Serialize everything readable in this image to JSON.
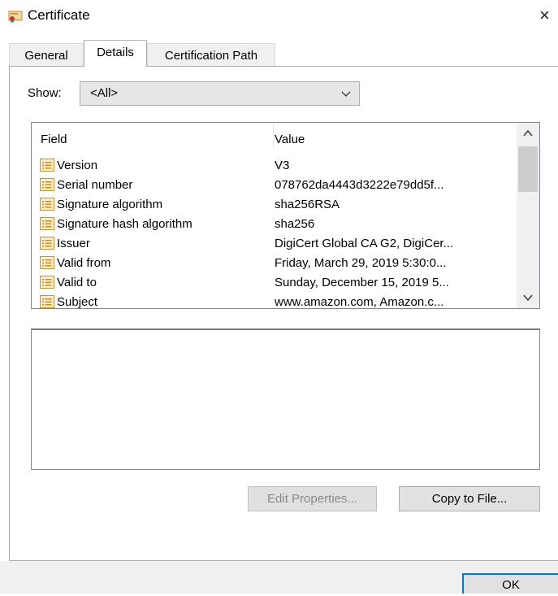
{
  "window": {
    "title": "Certificate",
    "title_icon": "certificate-icon",
    "close_glyph": "×"
  },
  "tabs": [
    {
      "label": "General",
      "selected": false
    },
    {
      "label": "Details",
      "selected": true
    },
    {
      "label": "Certification Path",
      "selected": false
    }
  ],
  "show": {
    "label": "Show:",
    "value": "<All>"
  },
  "list": {
    "headers": {
      "field": "Field",
      "value": "Value"
    },
    "rows": [
      {
        "field": "Version",
        "value": "V3"
      },
      {
        "field": "Serial number",
        "value": "078762da4443d3222e79dd5f..."
      },
      {
        "field": "Signature algorithm",
        "value": "sha256RSA"
      },
      {
        "field": "Signature hash algorithm",
        "value": "sha256"
      },
      {
        "field": "Issuer",
        "value": "DigiCert Global CA G2, DigiCer..."
      },
      {
        "field": "Valid from",
        "value": "Friday, March 29, 2019 5:30:0..."
      },
      {
        "field": "Valid to",
        "value": "Sunday, December 15, 2019 5..."
      },
      {
        "field": "Subject",
        "value": "www.amazon.com, Amazon.c..."
      }
    ]
  },
  "buttons": {
    "edit_properties": "Edit Properties...",
    "copy_to_file": "Copy to File...",
    "ok": "OK"
  },
  "colors": {
    "focus_border": "#0078d7",
    "disabled_text": "#8a8a8a"
  }
}
